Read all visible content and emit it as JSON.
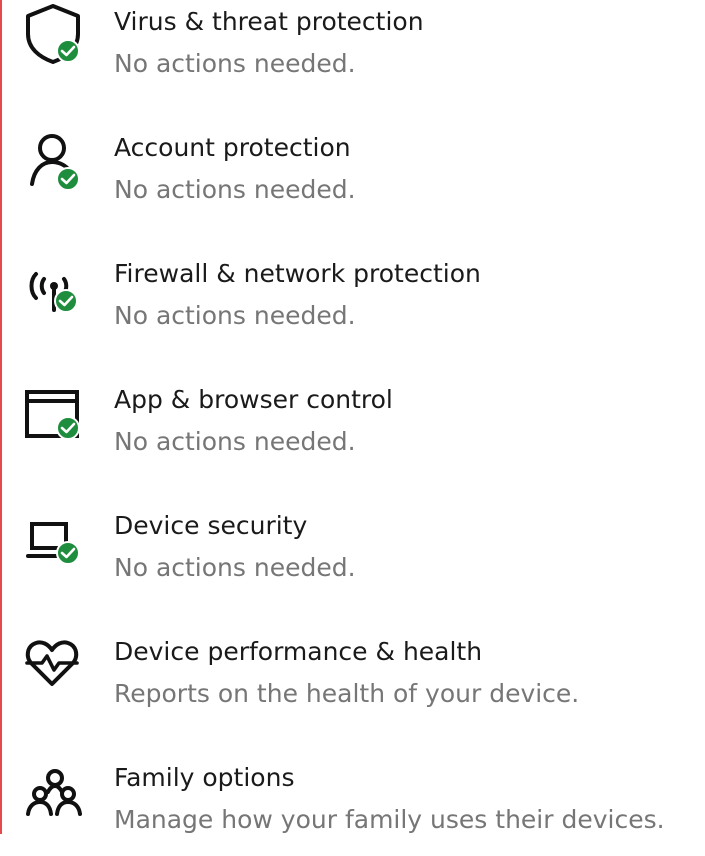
{
  "accent": {
    "status_ok": "#1e8e3e",
    "border_left": "#e5484d"
  },
  "items": [
    {
      "title": "Virus & threat protection",
      "description": "No actions needed.",
      "icon": "shield-check-icon"
    },
    {
      "title": "Account protection",
      "description": "No actions needed.",
      "icon": "person-check-icon"
    },
    {
      "title": "Firewall & network protection",
      "description": "No actions needed.",
      "icon": "antenna-check-icon"
    },
    {
      "title": "App & browser control",
      "description": "No actions needed.",
      "icon": "app-window-check-icon"
    },
    {
      "title": "Device security",
      "description": "No actions needed.",
      "icon": "device-check-icon"
    },
    {
      "title": "Device performance & health",
      "description": "Reports on the health of your device.",
      "icon": "heart-pulse-icon"
    },
    {
      "title": "Family options",
      "description": "Manage how your family uses their devices.",
      "icon": "family-icon"
    }
  ]
}
